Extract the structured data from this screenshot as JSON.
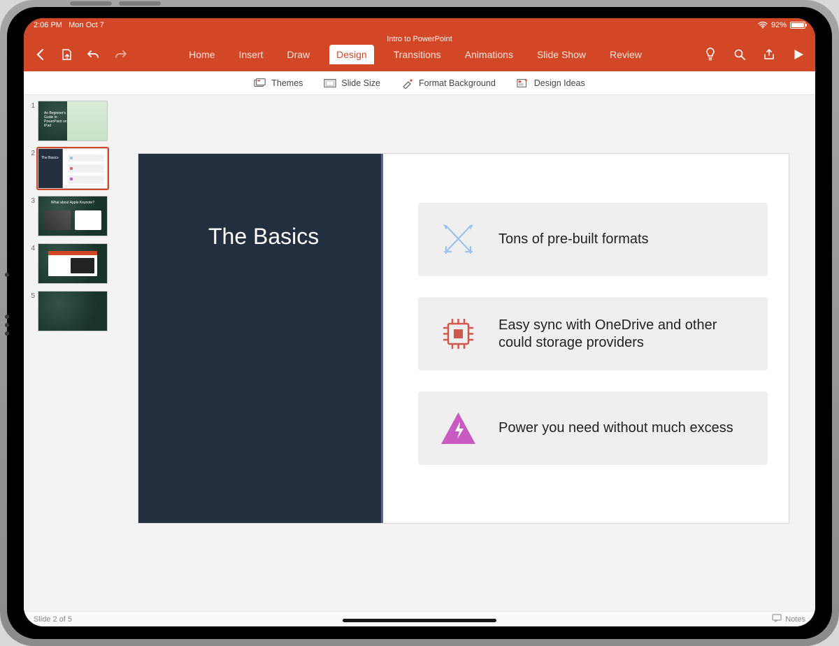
{
  "status": {
    "time": "2:06 PM",
    "date": "Mon Oct 7",
    "battery_pct": "92%"
  },
  "doc_title": "Intro to PowerPoint",
  "tabs": {
    "home": "Home",
    "insert": "Insert",
    "draw": "Draw",
    "design": "Design",
    "transitions": "Transitions",
    "animations": "Animations",
    "slideshow": "Slide Show",
    "review": "Review"
  },
  "design_bar": {
    "themes": "Themes",
    "slide_size": "Slide Size",
    "format_bg": "Format Background",
    "design_ideas": "Design Ideas"
  },
  "thumbs": {
    "t1_title": "An Beginner's\nGuide to\nPowerPoint on\niPad",
    "t2_title": "The Basics",
    "t3_title": "What about Apple Keynote?"
  },
  "slide": {
    "title": "The Basics",
    "point1": "Tons of pre-built formats",
    "point2": "Easy sync with OneDrive and other could storage providers",
    "point3": "Power you need without much excess"
  },
  "footer": {
    "slide_counter": "Slide 2 of 5",
    "notes": "Notes"
  }
}
